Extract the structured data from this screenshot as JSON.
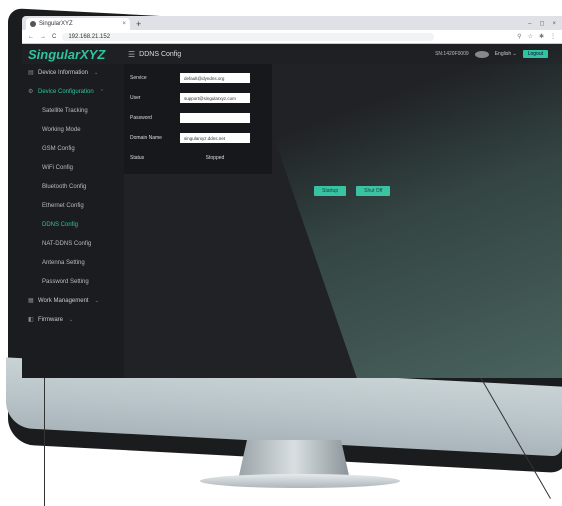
{
  "browser": {
    "tab_title": "SingularXYZ",
    "tab_close": "×",
    "new_tab": "+",
    "url": "192.168.21.152",
    "nav_back": "←",
    "nav_forward": "→",
    "nav_reload": "C",
    "win_min": "–",
    "win_max": "◻",
    "win_close": "×"
  },
  "header": {
    "logo": "SingularXYZ",
    "page_title": "DDNS Config",
    "serial": "SN:1420F0009",
    "language": "English ⌄",
    "logout": "Logout"
  },
  "sidebar": {
    "items": [
      {
        "label": "Device Information",
        "caret": "⌄"
      },
      {
        "label": "Device Configuration",
        "caret": "⌃"
      },
      {
        "label": "Satellite Tracking"
      },
      {
        "label": "Working Mode"
      },
      {
        "label": "GSM Config"
      },
      {
        "label": "WiFi Config"
      },
      {
        "label": "Bluetooth Config"
      },
      {
        "label": "Ethernet Config"
      },
      {
        "label": "DDNS Config"
      },
      {
        "label": "NAT-DDNS Config"
      },
      {
        "label": "Antenna Setting"
      },
      {
        "label": "Password Setting"
      },
      {
        "label": "Work Management",
        "caret": "⌄"
      },
      {
        "label": "Firmware",
        "caret": "⌄"
      }
    ]
  },
  "form": {
    "service_label": "Service",
    "service_value": "default@dyndns.org",
    "user_label": "User",
    "user_value": "support@singularxyz.com",
    "password_label": "Password",
    "password_value": "",
    "domain_label": "Domain Name",
    "domain_value": "singularxyz.ddns.net",
    "status_label": "Status",
    "status_value": "Stopped"
  },
  "buttons": {
    "startup": "Startup",
    "shut_off": "Shut Off"
  },
  "colors": {
    "accent": "#2ec4a0",
    "screen_bg": "#1c1e21"
  }
}
